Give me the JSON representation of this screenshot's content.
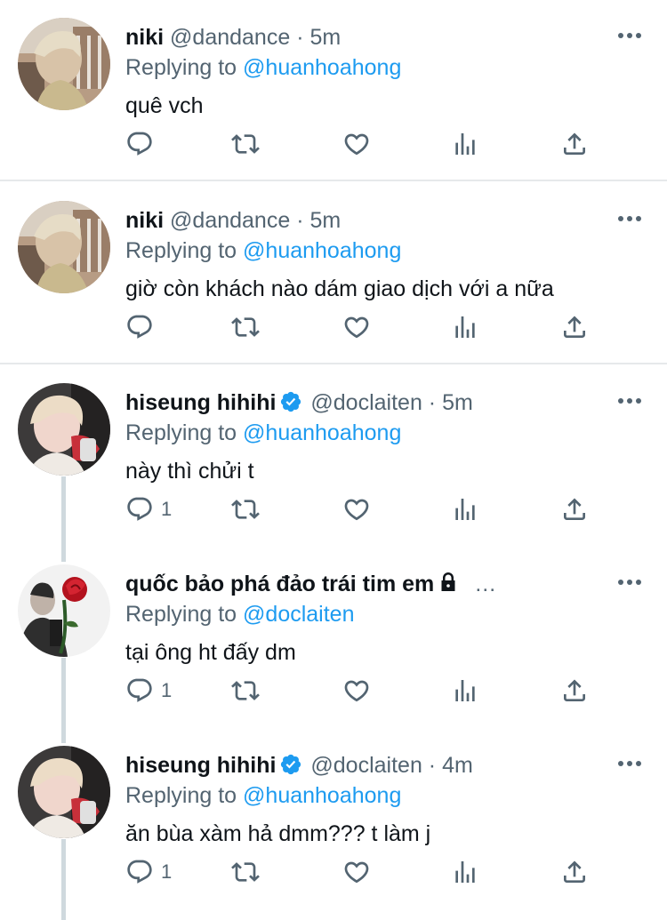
{
  "tweets": [
    {
      "name": "niki",
      "handle": "@dandance",
      "dot": "·",
      "time": "5m",
      "replying_prefix": "Replying to",
      "replying_to": "@huanhoahong",
      "text": "quê vch",
      "reply_count": "",
      "avatar": "avatar-niki"
    },
    {
      "name": "niki",
      "handle": "@dandance",
      "dot": "·",
      "time": "5m",
      "replying_prefix": "Replying to",
      "replying_to": "@huanhoahong",
      "text": "giờ còn khách nào dám giao dịch với a nữa",
      "reply_count": "",
      "avatar": "avatar-niki"
    },
    {
      "name": "hiseung hihihi",
      "handle": "@doclaiten",
      "dot": "·",
      "time": "5m",
      "verified": true,
      "replying_prefix": "Replying to",
      "replying_to": "@huanhoahong",
      "text": "này thì chửi t",
      "reply_count": "1",
      "avatar": "avatar-hiseung"
    },
    {
      "name": "quốc bảo phá đảo trái tim em",
      "locked": true,
      "truncation": "…",
      "replying_prefix": "Replying to",
      "replying_to": "@doclaiten",
      "text": "tại ông ht đấy dm",
      "reply_count": "1",
      "avatar": "avatar-rose"
    },
    {
      "name": "hiseung hihihi",
      "handle": "@doclaiten",
      "dot": "·",
      "time": "4m",
      "verified": true,
      "replying_prefix": "Replying to",
      "replying_to": "@huanhoahong",
      "text": "ăn bùa xàm hả dmm??? t làm j",
      "reply_count": "1",
      "avatar": "avatar-hiseung"
    }
  ],
  "colors": {
    "accent": "#1d9bf0",
    "secondary_text": "#536471",
    "primary_text": "#0f1419",
    "divider": "#e6e9eb",
    "thread_line": "#cfd9de"
  },
  "icons": [
    "reply-icon",
    "retweet-icon",
    "like-icon",
    "views-icon",
    "share-icon",
    "more-icon",
    "verified-badge-icon",
    "lock-icon"
  ]
}
